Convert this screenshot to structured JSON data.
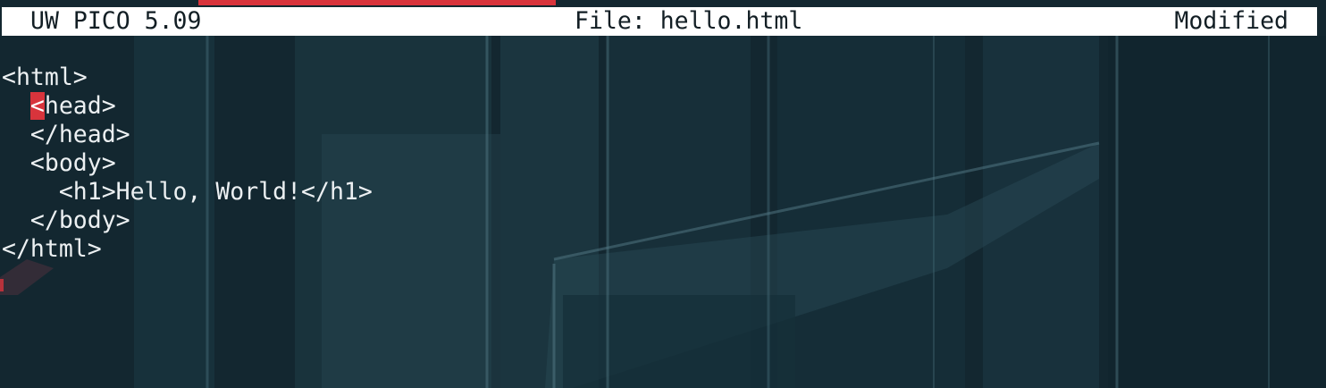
{
  "window": {
    "app_version": "UW PICO 5.09",
    "file_label": "File: hello.html",
    "status": "Modified"
  },
  "editor": {
    "cursor": {
      "line": 2,
      "column": 3
    },
    "lines": [
      {
        "indent": "",
        "text": "<html>"
      },
      {
        "indent": "  ",
        "cursor_char": "<",
        "text": "head>"
      },
      {
        "indent": "  ",
        "text": "</head>"
      },
      {
        "indent": "  ",
        "text": "<body>"
      },
      {
        "indent": "    ",
        "text": "<h1>Hello, World!</h1>"
      },
      {
        "indent": "  ",
        "text": "</body>"
      },
      {
        "indent": "",
        "text": "</html>"
      }
    ]
  },
  "colors": {
    "title_bar_background": "#ffffff",
    "title_bar_text": "#121e24",
    "accent": "#d8343c",
    "editor_text": "#ecf0f2",
    "background": "#14242b"
  }
}
